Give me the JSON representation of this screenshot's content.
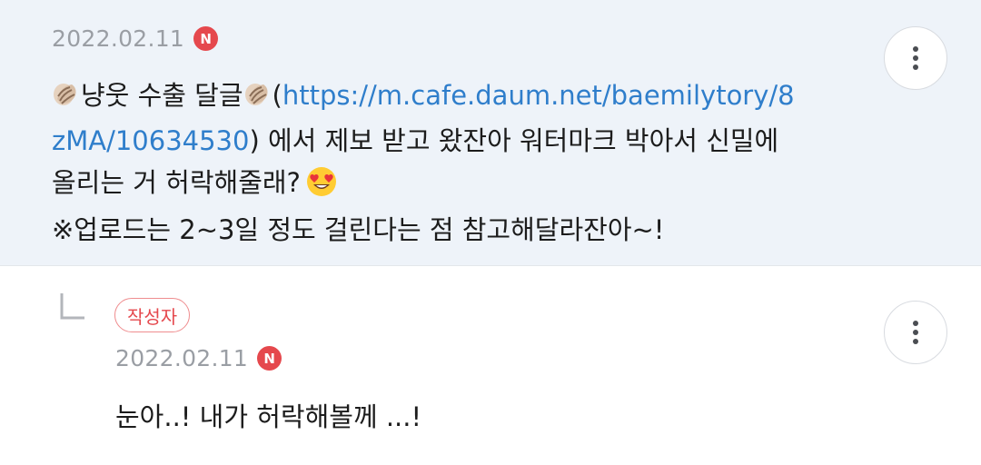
{
  "comment": {
    "date": "2022.02.11",
    "new_badge": "N",
    "line1_prefix": "냥웃 수출 달글",
    "line1_link": "https://m.cafe.daum.net/baemilytory/8",
    "line2_link": "zMA/10634530",
    "line2_rest": ") 에서 제보 받고 왔잔아 워터마크 박아서 신밀에",
    "open_paren": "(",
    "line3": "올리는 거 허락해줄래?",
    "line4": "※업로드는 2~3일 정도 걸린다는 점 참고해달라잔아~!"
  },
  "reply": {
    "author_badge": "작성자",
    "date": "2022.02.11",
    "new_badge": "N",
    "text": "눈아..! 내가 허락해볼께 ...!"
  },
  "icons": {
    "more": "more-vertical-icon",
    "shell": "spiral-shell-icon",
    "emoji": "heart-eyes-emoji-icon",
    "reply_arrow": "reply-corner-icon"
  },
  "colors": {
    "top_background": "#eef3f9",
    "link": "#2f7ecb",
    "new_badge": "#e5484d",
    "author_badge_text": "#e5484d",
    "date_text": "#9a9ea4"
  }
}
